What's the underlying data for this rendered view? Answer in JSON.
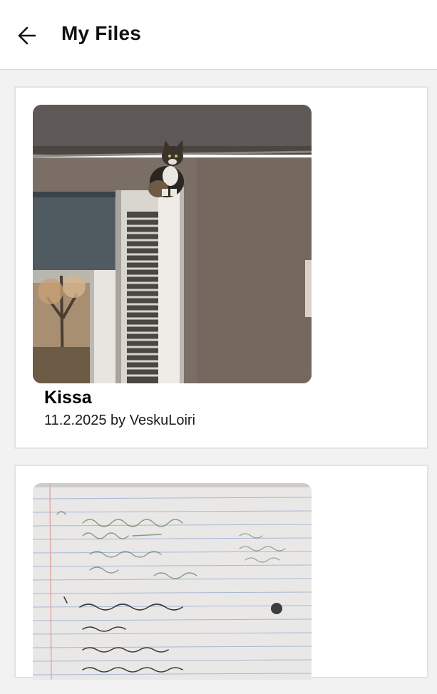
{
  "header": {
    "title": "My Files",
    "back_icon": "arrow-left-icon"
  },
  "files": [
    {
      "name": "Kissa",
      "meta": "11.2.2025 by VeskuLoiri",
      "thumbnail": "photo-cat-on-door"
    },
    {
      "name": "",
      "meta": "",
      "thumbnail": "photo-notebook-page"
    }
  ],
  "colors": {
    "background": "#f2f2f2",
    "surface": "#ffffff",
    "divider": "#d6d6d6"
  }
}
